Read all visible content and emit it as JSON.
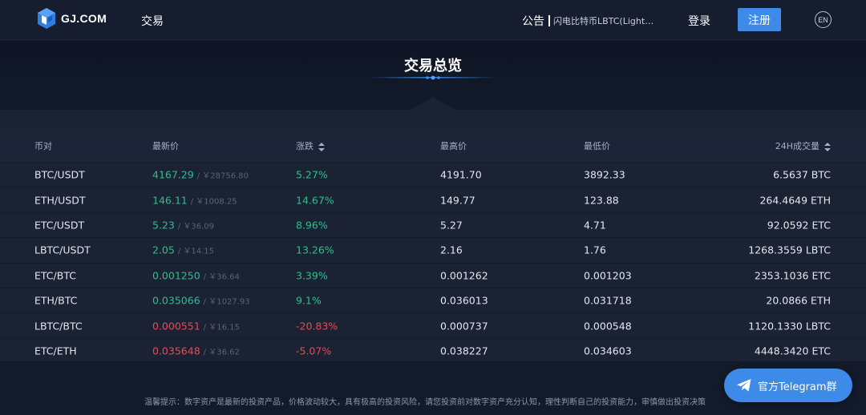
{
  "header": {
    "logo_text": "GJ.COM",
    "nav_trade": "交易",
    "notice_label": "公告",
    "notice_text": "闪电比特币LBTC(Lightning Bitcoin)",
    "login": "登录",
    "register": "注册",
    "lang": "EN"
  },
  "page": {
    "title": "交易总览"
  },
  "table": {
    "headers": {
      "pair": "币对",
      "price": "最新价",
      "change": "涨跌",
      "high": "最高价",
      "low": "最低价",
      "volume": "24H成交量"
    },
    "rows": [
      {
        "pair": "BTC/USDT",
        "price": "4167.29",
        "cny": "/ ￥28756.80",
        "change": "5.27%",
        "high": "4191.70",
        "low": "3892.33",
        "volume": "6.5637 BTC",
        "trend": "up"
      },
      {
        "pair": "ETH/USDT",
        "price": "146.11",
        "cny": "/ ￥1008.25",
        "change": "14.67%",
        "high": "149.77",
        "low": "123.88",
        "volume": "264.4649 ETH",
        "trend": "up"
      },
      {
        "pair": "ETC/USDT",
        "price": "5.23",
        "cny": "/ ￥36.09",
        "change": "8.96%",
        "high": "5.27",
        "low": "4.71",
        "volume": "92.0592 ETC",
        "trend": "up"
      },
      {
        "pair": "LBTC/USDT",
        "price": "2.05",
        "cny": "/ ￥14.15",
        "change": "13.26%",
        "high": "2.16",
        "low": "1.76",
        "volume": "1268.3559 LBTC",
        "trend": "up"
      },
      {
        "pair": "ETC/BTC",
        "price": "0.001250",
        "cny": "/ ￥36.64",
        "change": "3.39%",
        "high": "0.001262",
        "low": "0.001203",
        "volume": "2353.1036 ETC",
        "trend": "up"
      },
      {
        "pair": "ETH/BTC",
        "price": "0.035066",
        "cny": "/ ￥1027.93",
        "change": "9.1%",
        "high": "0.036013",
        "low": "0.031718",
        "volume": "20.0866 ETH",
        "trend": "up"
      },
      {
        "pair": "LBTC/BTC",
        "price": "0.000551",
        "cny": "/ ￥16.15",
        "change": "-20.83%",
        "high": "0.000737",
        "low": "0.000548",
        "volume": "1120.1330 LBTC",
        "trend": "down"
      },
      {
        "pair": "ETC/ETH",
        "price": "0.035648",
        "cny": "/ ￥36.62",
        "change": "-5.07%",
        "high": "0.038227",
        "low": "0.034603",
        "volume": "4448.3420 ETC",
        "trend": "down"
      }
    ]
  },
  "footer": {
    "disclaimer": "温馨提示：数字资产是最新的投资产品，价格波动较大，具有极高的投资风险，请您投资前对数字资产充分认知，理性判断自己的投资能力，审慎做出投资决策"
  },
  "telegram": {
    "label": "官方Telegram群"
  },
  "colors": {
    "up": "#2fbf8c",
    "down": "#f2474d",
    "accent": "#3d8ae8"
  },
  "icons": {
    "logo": "gj-logo-icon",
    "sort": "sort-icon",
    "telegram": "telegram-icon"
  }
}
